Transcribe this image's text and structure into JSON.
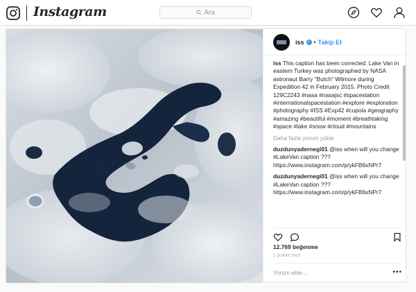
{
  "header": {
    "brand": "Instagram",
    "search_placeholder": "Ara"
  },
  "post": {
    "username": "iss",
    "follow_label": "Takip Et",
    "separator": "•",
    "caption_user": "iss",
    "caption_text": "This caption has been corrected: Lake Van in eastern Turkey was photographed by NASA astronaut Barry \"Butch\" Wilmore during Expedition 42 in February 2015. Photo Credit 129C2243 #nasa #nasajsc #spacestation #internationalspacestation #explore #exploration #photography #ISS #Exp42 #cupola #geography #amazing #beautiful #moment #breathtaking #space #lake #snow #cloud #mountains",
    "load_more": "Daha fazla yorum yükle",
    "comments": [
      {
        "user": "duzdunyadernegi01",
        "text": "@iss when will you change #LakeVan caption ??? https://www.instagram.com/p/ykFB6xNPr7"
      },
      {
        "user": "duzdunyadernegi01",
        "text": "@iss when will you change #LakeVan caption ??? https://www.instagram.com/p/ykFB6xNPr7"
      }
    ],
    "likes": "12.769 beğenme",
    "date": "1 ŞUBAT 2015",
    "add_comment_placeholder": "Yorum ekle...",
    "more_options": "•••"
  },
  "icons": {
    "brand_logo": "camera-icon",
    "explore": "compass-icon",
    "activity": "heart-icon",
    "profile": "person-icon",
    "like": "heart-icon",
    "comment": "comment-icon",
    "save": "bookmark-icon"
  },
  "colors": {
    "link": "#3897f0",
    "text": "#262626",
    "muted": "#999999"
  }
}
